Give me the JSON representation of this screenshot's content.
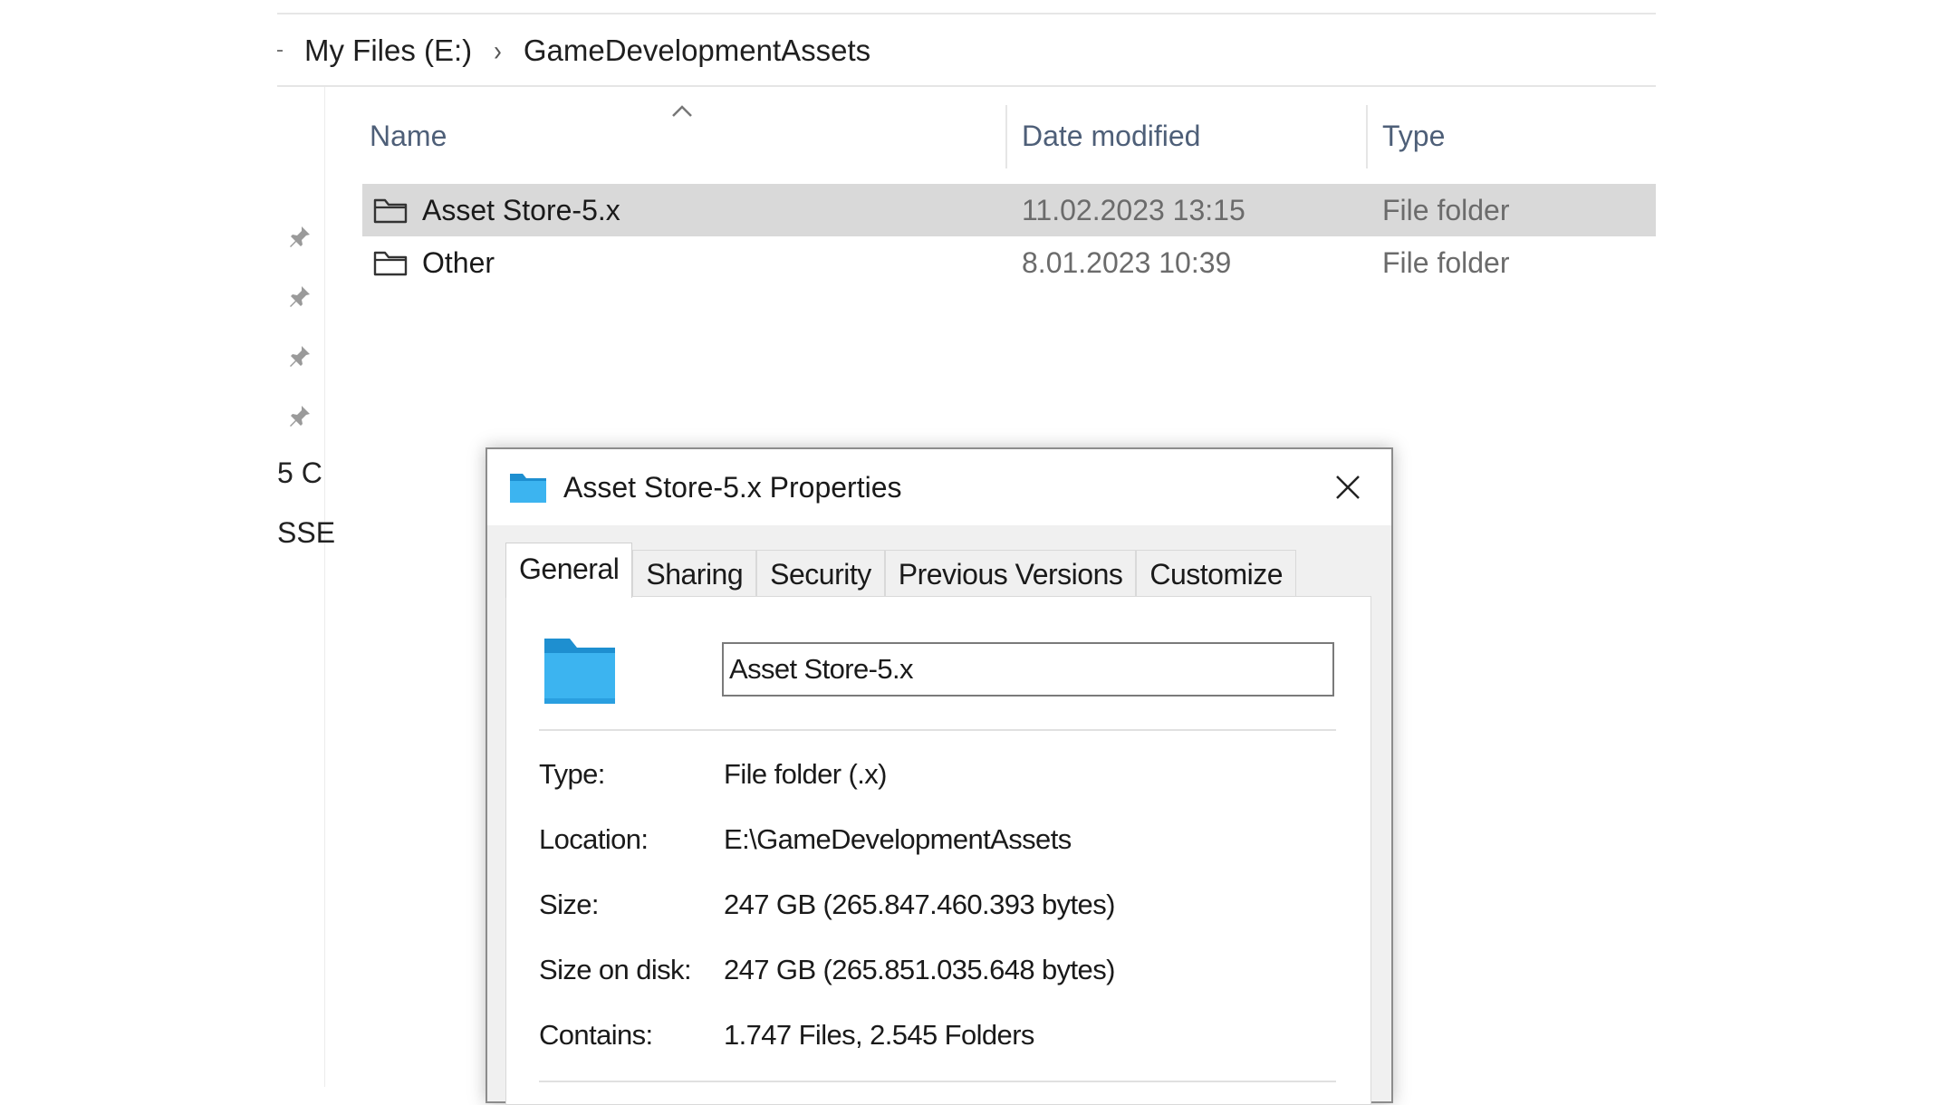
{
  "breadcrumb": {
    "items": [
      "My Files (E:)",
      "GameDevelopmentAssets"
    ],
    "separator": "›"
  },
  "nav_pane": {
    "pins": [
      "pin-icon",
      "pin-icon",
      "pin-icon",
      "pin-icon"
    ],
    "texts": [
      "5 C",
      "SSE"
    ]
  },
  "columns": {
    "name": "Name",
    "date": "Date modified",
    "type": "Type"
  },
  "files": [
    {
      "name": "Asset Store-5.x",
      "date": "11.02.2023 13:15",
      "type": "File folder",
      "selected": true,
      "icon": "folder-outline-icon"
    },
    {
      "name": "Other",
      "date": "8.01.2023 10:39",
      "type": "File folder",
      "selected": false,
      "icon": "folder-outline-icon"
    }
  ],
  "dialog": {
    "title": "Asset Store-5.x Properties",
    "tabs": [
      "General",
      "Sharing",
      "Security",
      "Previous Versions",
      "Customize"
    ],
    "active_tab": "General",
    "folder_name": "Asset Store-5.x",
    "properties": [
      {
        "label": "Type:",
        "value": "File folder (.x)"
      },
      {
        "label": "Location:",
        "value": "E:\\GameDevelopmentAssets"
      },
      {
        "label": "Size:",
        "value": "247 GB (265.847.460.393 bytes)"
      },
      {
        "label": "Size on disk:",
        "value": "247 GB (265.851.035.648 bytes)"
      },
      {
        "label": "Contains:",
        "value": "1.747 Files, 2.545 Folders"
      }
    ]
  },
  "colors": {
    "selection": "#d9d9d9",
    "header_text": "#4e5f78",
    "folder_blue": "#1e9ad9"
  }
}
